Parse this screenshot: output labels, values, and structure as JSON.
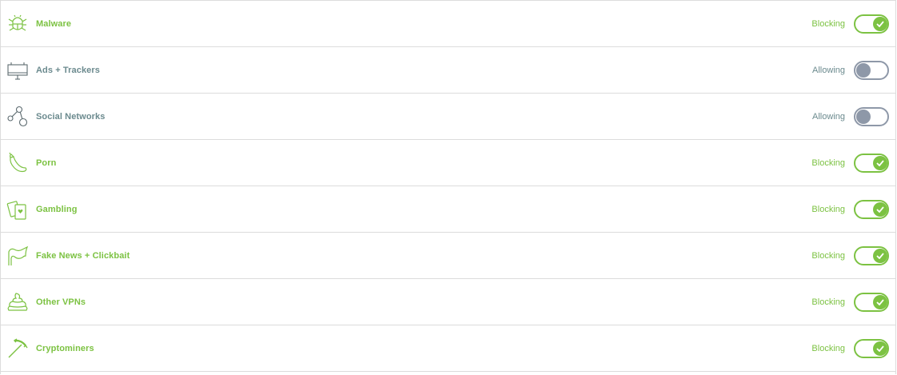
{
  "colors": {
    "blocking": "#7cc242",
    "allowing": "#8e98a8",
    "allowing_text": "#6b8a8e",
    "divider": "#dcdcdc"
  },
  "rows": [
    {
      "label": "Malware",
      "status": "Blocking",
      "enabled": true,
      "icon": "bug-icon"
    },
    {
      "label": "Ads + Trackers",
      "status": "Allowing",
      "enabled": false,
      "icon": "billboard-icon"
    },
    {
      "label": "Social Networks",
      "status": "Allowing",
      "enabled": false,
      "icon": "social-network-icon"
    },
    {
      "label": "Porn",
      "status": "Blocking",
      "enabled": true,
      "icon": "eggplant-icon"
    },
    {
      "label": "Gambling",
      "status": "Blocking",
      "enabled": true,
      "icon": "playing-cards-icon"
    },
    {
      "label": "Fake News + Clickbait",
      "status": "Blocking",
      "enabled": true,
      "icon": "flag-icon"
    },
    {
      "label": "Other VPNs",
      "status": "Blocking",
      "enabled": true,
      "icon": "poop-icon"
    },
    {
      "label": "Cryptominers",
      "status": "Blocking",
      "enabled": true,
      "icon": "pickaxe-icon"
    }
  ]
}
